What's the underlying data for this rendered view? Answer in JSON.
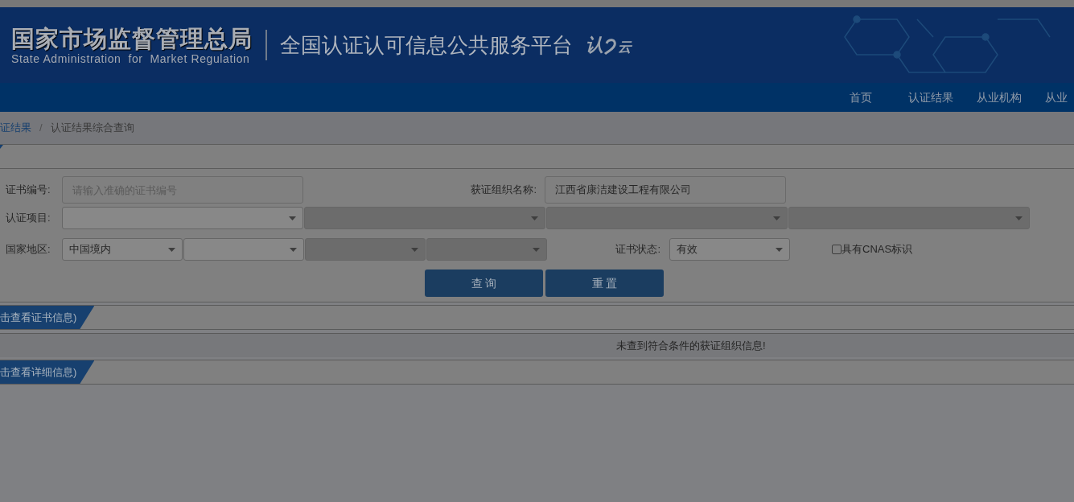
{
  "header": {
    "agency_name": "国家市场监督管理总局",
    "agency_name_en": "State Administration  for  Market Regulation",
    "platform_title": "全国认证认可信息公共服务平台",
    "logo_chars": [
      "认",
      "云"
    ]
  },
  "nav": [
    {
      "label": "首页"
    },
    {
      "label": "认证结果"
    },
    {
      "label": "从业机构"
    },
    {
      "label": "从业"
    }
  ],
  "breadcrumb": [
    {
      "label": "证结果",
      "kind": "link"
    },
    {
      "label": "认证结果综合查询",
      "kind": "current"
    }
  ],
  "breadcrumb_separator": "/",
  "form": {
    "cert_no": {
      "label": "证书编号:",
      "placeholder": "请输入准确的证书编号"
    },
    "org_name": {
      "label": "获证组织名称:",
      "value": "江西省康洁建设工程有限公司"
    },
    "cert_project": {
      "label": "认证项目:",
      "selects": [
        {
          "disabled": false
        },
        {
          "disabled": true
        },
        {
          "disabled": true
        },
        {
          "disabled": true
        }
      ]
    },
    "region": {
      "label": "国家地区:",
      "selects": [
        {
          "value": "中国境内",
          "disabled": false
        },
        {
          "disabled": false
        },
        {
          "disabled": true
        },
        {
          "disabled": true
        }
      ]
    },
    "cert_status": {
      "label": "证书状态:",
      "value": "有效"
    },
    "cnas": {
      "label": "具有CNAS标识",
      "checked": false
    },
    "buttons": [
      "查 询",
      "重 置"
    ]
  },
  "sections": [
    {
      "tab": "击查看证书信息)"
    },
    {
      "message": "未查到符合条件的获证组织信息!"
    },
    {
      "tab": "击查看详细信息)"
    }
  ]
}
